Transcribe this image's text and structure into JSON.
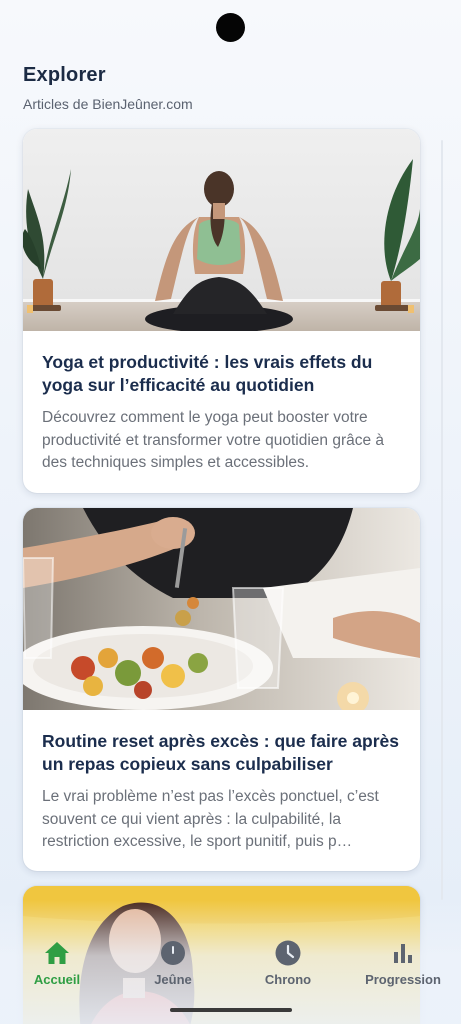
{
  "header": {
    "title": "Explorer",
    "subtitle": "Articles de BienJeûner.com"
  },
  "articles": [
    {
      "title": "Yoga et productivité : les vrais effets du yoga sur l’efficacité au quotidien",
      "description": "Découvrez comment le yoga peut booster votre productivité et transformer votre quotidien grâce à des techniques simples et accessibles.",
      "image": "yoga-meditation-photo"
    },
    {
      "title": "Routine reset après excès : que faire après un repas copieux sans culpabiliser",
      "description": "Le vrai problème n’est pas l’excès ponctuel, c’est souvent ce qui vient après : la culpabilité, la restriction excessive, le sport punitif, puis p…",
      "image": "plate-of-roasted-vegetables-photo"
    },
    {
      "image": "woman-yellow-background-photo"
    }
  ],
  "nav": {
    "items": [
      {
        "label": "Accueil",
        "icon": "home-icon",
        "active": true
      },
      {
        "label": "Jeûne",
        "icon": "timer-icon",
        "active": false
      },
      {
        "label": "Chrono",
        "icon": "clock-icon",
        "active": false
      },
      {
        "label": "Progression",
        "icon": "bar-chart-icon",
        "active": false
      }
    ]
  },
  "colors": {
    "accent_active": "#2f9e44",
    "title": "#1c2b44",
    "inactive": "#5d6470"
  }
}
